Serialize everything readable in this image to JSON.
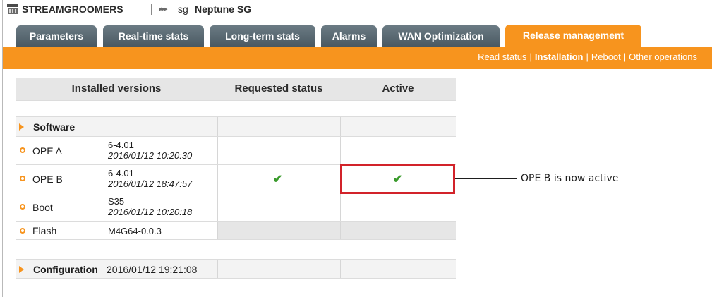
{
  "header": {
    "app_title": "STREAMGROOMERS",
    "breadcrumb_arrows": "▸▸▸",
    "breadcrumb_prefix": "sg",
    "breadcrumb_name": "Neptune SG"
  },
  "tabs": [
    {
      "label": "Parameters",
      "active": false
    },
    {
      "label": "Real-time stats",
      "active": false
    },
    {
      "label": "Long-term stats",
      "active": false
    },
    {
      "label": "Alarms",
      "active": false
    },
    {
      "label": "WAN Optimization",
      "active": false
    },
    {
      "label": "Release management",
      "active": true
    }
  ],
  "subnav": {
    "items": [
      "Read status",
      "Installation",
      "Reboot",
      "Other operations"
    ],
    "current": "Installation",
    "separator": "|"
  },
  "table": {
    "columns": [
      "Installed versions",
      "Requested status",
      "Active"
    ],
    "sections": [
      {
        "label": "Software",
        "rows": [
          {
            "name": "OPE A",
            "version": "6-4.01",
            "date": "2016/01/12 10:20:30",
            "requested": "",
            "active": ""
          },
          {
            "name": "OPE B",
            "version": "6-4.01",
            "date": "2016/01/12 18:47:57",
            "requested": "✔",
            "active": "✔"
          },
          {
            "name": "Boot",
            "version": "S35",
            "date": "2016/01/12 10:20:18",
            "requested": "",
            "active": ""
          },
          {
            "name": "Flash",
            "version": "M4G64-0.0.3",
            "date": "",
            "requested": "",
            "active": ""
          }
        ]
      },
      {
        "label": "Configuration",
        "value": "2016/01/12 19:21:08"
      }
    ]
  },
  "annotation": {
    "text": "OPE B is now active",
    "color": "#d2232a"
  },
  "colors": {
    "accent": "#f7941e",
    "tab_inactive": "#556670",
    "check": "#3a9b2c"
  }
}
